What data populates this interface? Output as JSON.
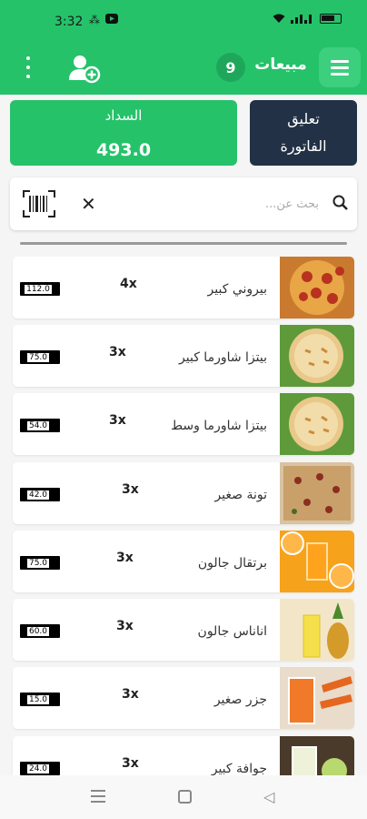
{
  "status_bar": {
    "time": "3:32",
    "left_icons": [
      "share-icon",
      "youtube-icon"
    ],
    "right_icons": [
      "wifi-icon",
      "signal-icon",
      "battery-icon"
    ]
  },
  "header": {
    "title": "مبيعات",
    "count": "9"
  },
  "payment": {
    "label": "السداد",
    "amount": "493.0"
  },
  "hold_invoice": {
    "line1": "تعليق",
    "line2": "الفاتورة"
  },
  "search": {
    "placeholder": "بحث عن..."
  },
  "products": [
    {
      "name": "بيروني كبير",
      "qty": "4x",
      "price": "112.0",
      "image": "pepperoni-pizza"
    },
    {
      "name": "بيتزا شاورما كبير",
      "qty": "3x",
      "price": "75.0",
      "image": "shawarma-pizza"
    },
    {
      "name": "بيتزا شاورما وسط",
      "qty": "3x",
      "price": "54.0",
      "image": "shawarma-pizza"
    },
    {
      "name": "تونة صغير",
      "qty": "3x",
      "price": "42.0",
      "image": "tuna-pizza"
    },
    {
      "name": "برتقال جالون",
      "qty": "3x",
      "price": "75.0",
      "image": "orange-juice"
    },
    {
      "name": "اناناس جالون",
      "qty": "3x",
      "price": "60.0",
      "image": "pineapple-juice"
    },
    {
      "name": "جزر صغير",
      "qty": "3x",
      "price": "15.0",
      "image": "carrot-juice"
    },
    {
      "name": "جوافة كبير",
      "qty": "3x",
      "price": "24.0",
      "image": "guava-juice"
    }
  ],
  "colors": {
    "primary": "#25c26a",
    "dark": "#223146",
    "badge": "#1ea75a"
  }
}
